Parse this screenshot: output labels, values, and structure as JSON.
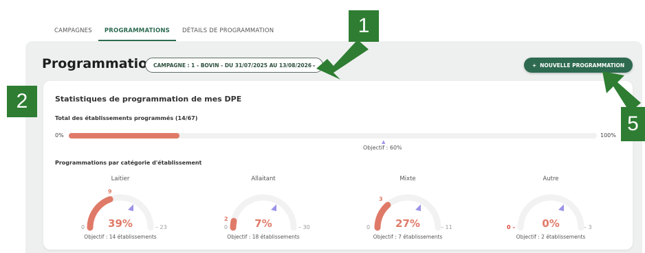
{
  "tabs": [
    {
      "label": "CAMPAGNES"
    },
    {
      "label": "PROGRAMMATIONS"
    },
    {
      "label": "DÉTAILS DE PROGRAMMATION"
    }
  ],
  "header": {
    "title": "Programmations",
    "campaign_select": "CAMPAGNE : 1 - BOVIN - DU 31/07/2025 AU 13/08/2026",
    "new_button": "NOUVELLE PROGRAMMATION",
    "new_button_icon": "+"
  },
  "stats": {
    "title": "Statistiques de programmation de mes DPE",
    "total_label": "Total des établissements programmés (14/67)",
    "min_label": "0%",
    "max_label": "100%",
    "progress_fraction": 0.21,
    "objective_label": "Objectif : 60%",
    "category_label": "Programmations par catégorie d'établissement"
  },
  "gauges": [
    {
      "title": "Laitier",
      "value": "9",
      "min": "0",
      "max": "23",
      "pct": "39%",
      "fraction": 0.39,
      "objective": "Objectif : 14 établissements"
    },
    {
      "title": "Allaitant",
      "value": "2",
      "min": "0",
      "max": "30",
      "pct": "7%",
      "fraction": 0.07,
      "objective": "Objectif : 18 établissements"
    },
    {
      "title": "Mixte",
      "value": "3",
      "min": "0",
      "max": "11",
      "pct": "27%",
      "fraction": 0.27,
      "objective": "Objectif : 7 établissements"
    },
    {
      "title": "Autre",
      "value": "",
      "min": "0",
      "max": "3",
      "pct": "0%",
      "fraction": 0.0,
      "objective": "Objectif : 2 établissements"
    }
  ],
  "callouts": [
    "1",
    "2",
    "5"
  ],
  "colors": {
    "accent": "#2d6a4f",
    "progress": "#e07a68",
    "objective": "#9b93e8",
    "callout": "#2e7d32"
  }
}
